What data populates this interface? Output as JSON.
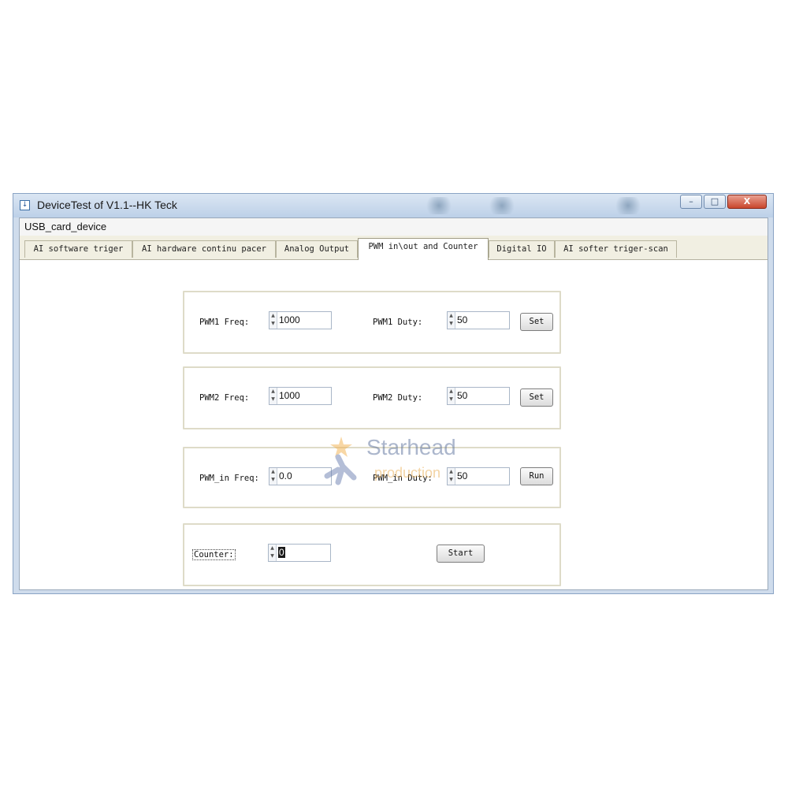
{
  "window": {
    "title": "DeviceTest of V1.1--HK Teck",
    "icon": "app-window-icon",
    "controls": {
      "minimize": "–",
      "maximize": "□",
      "close": "X"
    }
  },
  "menu": {
    "items": [
      "USB_card_device"
    ]
  },
  "tabs": [
    {
      "label": "AI software triger",
      "active": false
    },
    {
      "label": "AI hardware continu pacer",
      "active": false
    },
    {
      "label": "Analog Output",
      "active": false
    },
    {
      "label": "PWM in\\out and Counter",
      "active": true
    },
    {
      "label": "Digital IO",
      "active": false
    },
    {
      "label": "AI softer triger-scan",
      "active": false
    }
  ],
  "pwm1": {
    "freq_label": "PWM1 Freq:",
    "freq_value": "1000",
    "duty_label": "PWM1 Duty:",
    "duty_value": "50",
    "button": "Set"
  },
  "pwm2": {
    "freq_label": "PWM2 Freq:",
    "freq_value": "1000",
    "duty_label": "PWM2 Duty:",
    "duty_value": "50",
    "button": "Set"
  },
  "pwm_in": {
    "freq_label": "PWM_in Freq:",
    "freq_value": "0.0",
    "duty_label": "PWM_in Duty:",
    "duty_value": "50",
    "button": "Run"
  },
  "counter": {
    "label": "Counter:",
    "value": "0",
    "button": "Start"
  },
  "watermark": {
    "line1": "Starhead",
    "line2": "production"
  },
  "colors": {
    "titlebar": "#bcd0e8",
    "close_button": "#c9462c",
    "tabstrip": "#f1efe2",
    "group_border": "#dedbc8"
  }
}
